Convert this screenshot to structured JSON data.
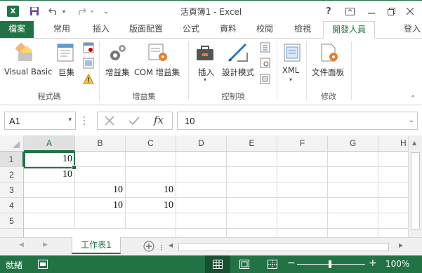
{
  "window": {
    "title": "活頁簿1 - Excel",
    "app_icon_letter": "X",
    "help_label": "?",
    "controls": [
      "help-icon",
      "ribbon-display-icon",
      "minimize-icon",
      "restore-icon",
      "close-icon"
    ]
  },
  "tabs": [
    {
      "label": "檔案"
    },
    {
      "label": "常用"
    },
    {
      "label": "插入"
    },
    {
      "label": "版面配置"
    },
    {
      "label": "公式"
    },
    {
      "label": "資料"
    },
    {
      "label": "校閱"
    },
    {
      "label": "檢視"
    },
    {
      "label": "開發人員"
    }
  ],
  "signin_label": "登入",
  "ribbon": {
    "groups": [
      {
        "label": "程式碼",
        "buttons": [
          "Visual Basic",
          "巨集"
        ]
      },
      {
        "label": "增益集",
        "buttons": [
          "增益集",
          "COM 增益集"
        ]
      },
      {
        "label": "控制項",
        "buttons": [
          "插入",
          "設計模式"
        ]
      },
      {
        "label": "",
        "buttons": [
          "XML"
        ]
      },
      {
        "label": "修改",
        "buttons": [
          "文件面板"
        ]
      }
    ]
  },
  "name_box": "A1",
  "formula_value": "10",
  "fx_label": "fx",
  "columns": [
    "A",
    "B",
    "C",
    "D",
    "E",
    "F",
    "G",
    "H"
  ],
  "rows": [
    {
      "num": "1",
      "cells": [
        "10",
        "",
        ""
      ]
    },
    {
      "num": "2",
      "cells": [
        "10",
        "",
        ""
      ]
    },
    {
      "num": "3",
      "cells": [
        "",
        "10",
        "10"
      ]
    },
    {
      "num": "4",
      "cells": [
        "",
        "10",
        "10"
      ]
    },
    {
      "num": "5",
      "cells": [
        "",
        "",
        ""
      ]
    }
  ],
  "sheet_tab": "工作表1",
  "status": {
    "ready": "就緒",
    "zoom": "100%"
  },
  "colors": {
    "accent": "#217346"
  }
}
